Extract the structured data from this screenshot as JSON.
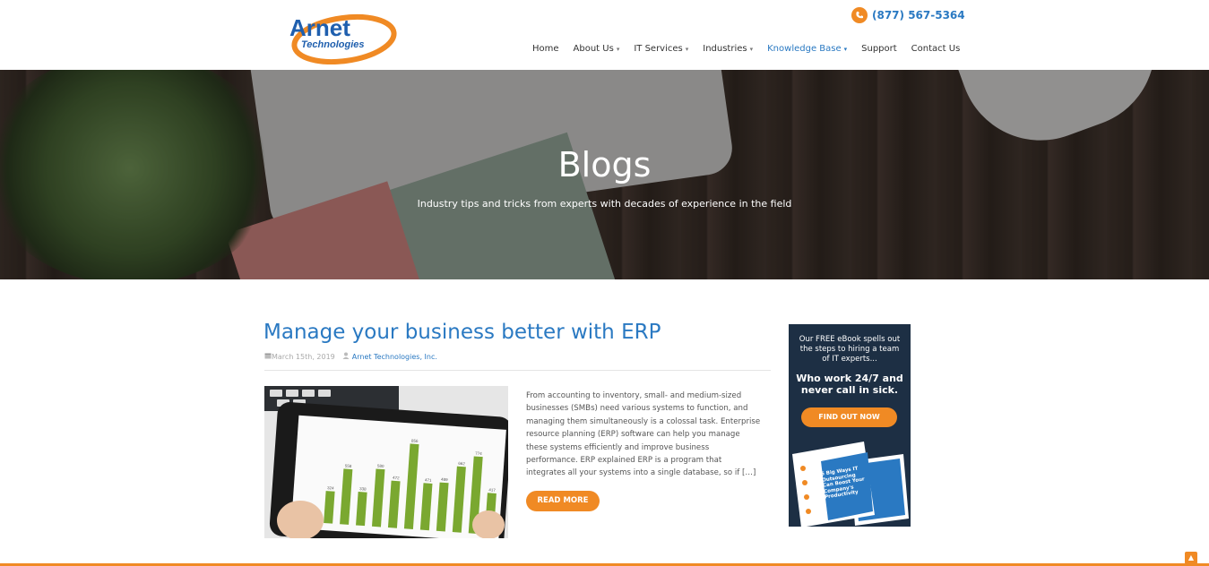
{
  "header": {
    "logo_text_main": "Arnet",
    "logo_text_sub": "Technologies",
    "phone": "(877) 567-5364",
    "nav": [
      {
        "label": "Home",
        "has_caret": false,
        "active": false
      },
      {
        "label": "About Us",
        "has_caret": true,
        "active": false
      },
      {
        "label": "IT Services",
        "has_caret": true,
        "active": false
      },
      {
        "label": "Industries",
        "has_caret": true,
        "active": false
      },
      {
        "label": "Knowledge Base",
        "has_caret": true,
        "active": true
      },
      {
        "label": "Support",
        "has_caret": false,
        "active": false
      },
      {
        "label": "Contact Us",
        "has_caret": false,
        "active": false
      }
    ],
    "caret_glyph": "▾"
  },
  "hero": {
    "title": "Blogs",
    "subtitle": "Industry tips and tricks from experts with decades of experience in the field"
  },
  "post": {
    "title": "Manage your business better with ERP",
    "date": "March 15th, 2019",
    "author": "Arnet Technologies, Inc.",
    "excerpt": "From accounting to inventory, small- and medium-sized businesses (SMBs) need various systems to function, and managing them simultaneously is a colossal task. Enterprise resource planning (ERP) software can help you manage these systems efficiently and improve business performance. ERP explained ERP is a program that integrates all your systems into a single database, so if […]",
    "read_more": "READ MORE",
    "image_chart_labels": [
      "324",
      "558",
      "338",
      "580",
      "472",
      "856",
      "471",
      "489",
      "662",
      "774",
      "417"
    ]
  },
  "sidebar_ad": {
    "intro": "Our FREE eBook spells out the steps to hiring a team of IT experts...",
    "headline": "Who work 24/7 and never call in sick.",
    "button": "FIND OUT NOW",
    "book_title": "5 Big Ways IT Outsourcing Can Boost Your Company's Productivity"
  },
  "colors": {
    "brand_blue": "#2a79c2",
    "accent_orange": "#f08a24",
    "ad_background": "#1d2f44"
  },
  "icons": {
    "phone": "phone-icon",
    "calendar": "calendar-icon",
    "user": "user-icon",
    "scroll_top": "chevron-up-icon"
  }
}
